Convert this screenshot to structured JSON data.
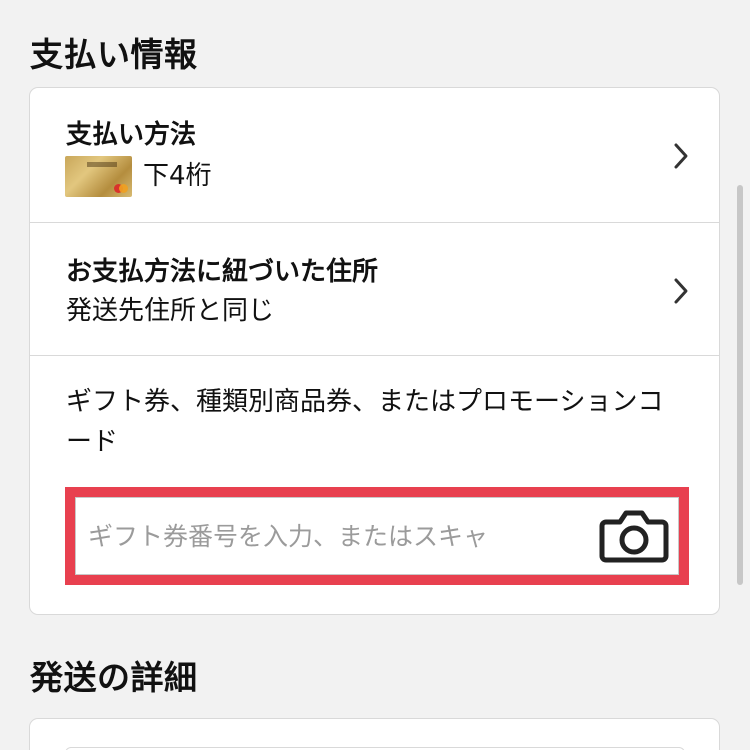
{
  "payment_section": {
    "title": "支払い情報",
    "payment_method": {
      "title": "支払い方法",
      "card_suffix": "下4桁"
    },
    "billing_address": {
      "title": "お支払方法に紐づいた住所",
      "value": "発送先住所と同じ"
    },
    "gift_card": {
      "label": "ギフト券、種類別商品券、またはプロモーションコード",
      "input_placeholder": "ギフト券番号を入力、またはスキャ",
      "input_value": ""
    }
  },
  "shipping_section": {
    "title": "発送の詳細"
  },
  "icons": {
    "chevron": "chevron-right-icon",
    "camera": "camera-icon",
    "card": "credit-card-thumbnail"
  },
  "colors": {
    "highlight_border": "#e8404f",
    "background": "#f2f2f2",
    "card_background": "#ffffff"
  }
}
